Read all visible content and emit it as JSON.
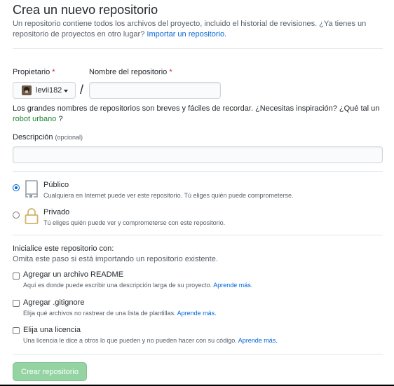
{
  "header": {
    "title": "Crea un nuevo repositorio",
    "subtitle": "Un repositorio contiene todos los archivos del proyecto, incluido el historial de revisiones. ¿Ya tienes un repositorio de proyectos en otro lugar?",
    "import_link": "Importar un repositorio."
  },
  "owner": {
    "label": "Propietario",
    "required_mark": "*",
    "value": "levii182"
  },
  "repo_name": {
    "label": "Nombre del repositorio",
    "required_mark": "*",
    "value": "",
    "separator": "/"
  },
  "name_hint": {
    "text": "Los grandes nombres de repositorios son breves y fáciles de recordar. ¿Necesitas inspiración? ¿Qué tal un",
    "suggestion": "robot urbano",
    "suffix": "?"
  },
  "description": {
    "label": "Descripción",
    "optional": "(opcional)",
    "value": ""
  },
  "visibility": {
    "selected": "public",
    "public": {
      "title": "Público",
      "desc": "Cualquiera en Internet puede ver este repositorio. Tú eliges quién puede comprometerse."
    },
    "private": {
      "title": "Privado",
      "desc": "Tú eliges quién puede ver y comprometerse con este repositorio."
    }
  },
  "init": {
    "title": "Inicialice este repositorio con:",
    "subtitle": "Omita este paso si está importando un repositorio existente.",
    "options": [
      {
        "label": "Agregar un archivo README",
        "desc": "Aquí es donde puede escribir una descripción larga de su proyecto.",
        "link": "Aprende más.",
        "checked": false
      },
      {
        "label": "Agregar .gitignore",
        "desc": "Elija qué archivos no rastrear de una lista de plantillas.",
        "link": "Aprende más.",
        "checked": false
      },
      {
        "label": "Elija una licencia",
        "desc": "Una licencia le dice a otros lo que pueden y no pueden hacer con su código.",
        "link": "Aprende más.",
        "checked": false
      }
    ]
  },
  "submit": {
    "label": "Crear repositorio",
    "enabled": false
  },
  "colors": {
    "link": "#0366d6",
    "required": "#cb2431",
    "submit_disabled": "#94d3a2",
    "suggestion": "#22863a"
  }
}
